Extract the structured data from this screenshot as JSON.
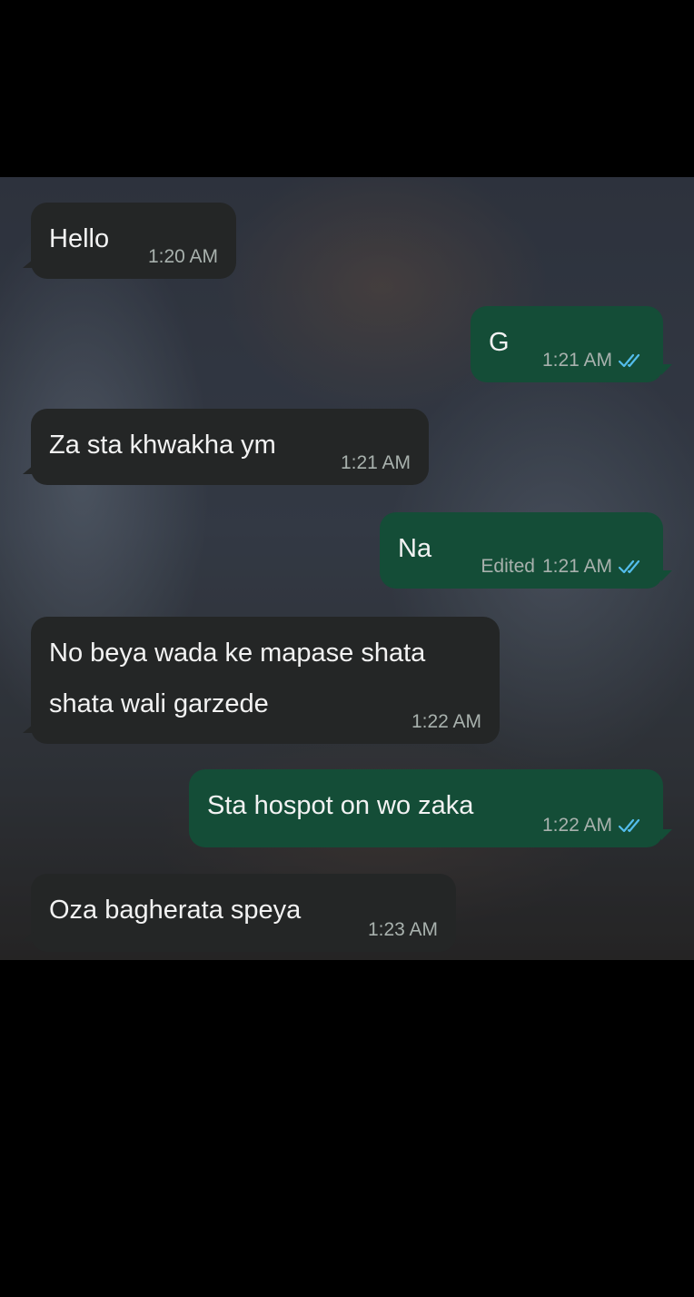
{
  "messages": [
    {
      "direction": "in",
      "text": "Hello",
      "time": "1:20 AM"
    },
    {
      "direction": "out",
      "text": "G",
      "time": "1:21 AM",
      "status": "read-double-check-icon"
    },
    {
      "direction": "in",
      "text": "Za sta khwakha ym",
      "time": "1:21 AM"
    },
    {
      "direction": "out",
      "text": "Na",
      "edited": "Edited",
      "time": "1:21 AM",
      "status": "read-double-check-icon"
    },
    {
      "direction": "in",
      "text": "No beya wada ke mapase shata\nshata wali garzede",
      "time": "1:22 AM"
    },
    {
      "direction": "out",
      "text": "Sta hospot on wo zaka",
      "time": "1:22 AM",
      "status": "read-double-check-icon"
    },
    {
      "direction": "in",
      "text": "Oza bagherata speya",
      "time": "1:23 AM"
    }
  ],
  "colors": {
    "incoming_bubble": "#242626",
    "outgoing_bubble": "#144d37",
    "read_ticks": "#53bdeb",
    "timestamp": "#a8b1ad"
  }
}
